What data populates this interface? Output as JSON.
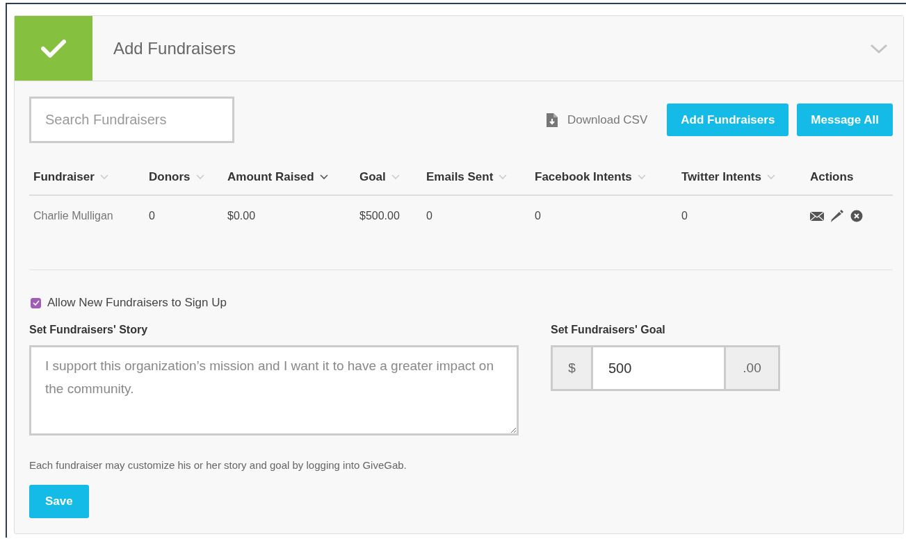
{
  "panel": {
    "title": "Add Fundraisers",
    "completed": true,
    "expanded": true
  },
  "toolbar": {
    "search": {
      "placeholder": "Search Fundraisers"
    },
    "download_link": "Download CSV",
    "buttons": [
      "Add Fundraisers",
      "Message All"
    ]
  },
  "table": {
    "columns": [
      {
        "label": "Fundraiser",
        "sortable": true,
        "sorted": false
      },
      {
        "label": "Donors",
        "sortable": true,
        "sorted": false
      },
      {
        "label": "Amount Raised",
        "sortable": true,
        "sorted": true
      },
      {
        "label": "Goal",
        "sortable": true,
        "sorted": false
      },
      {
        "label": "Emails Sent",
        "sortable": true,
        "sorted": false
      },
      {
        "label": "Facebook Intents",
        "sortable": true,
        "sorted": false
      },
      {
        "label": "Twitter Intents",
        "sortable": true,
        "sorted": false
      },
      {
        "label": "Actions",
        "sortable": false
      }
    ],
    "rows": [
      {
        "cells": [
          "Charlie Mulligan",
          "0",
          "$0.00",
          "$500.00",
          "0",
          "0",
          "0"
        ]
      }
    ]
  },
  "settings": {
    "allow_signup": {
      "label": "Allow New Fundraisers to Sign Up",
      "checked": true
    },
    "story": {
      "label": "Set Fundraisers' Story",
      "placeholder": "I support this organization’s mission and I want it to have a greater impact on the community."
    },
    "goal": {
      "label": "Set Fundraisers' Goal",
      "prefix": "$",
      "value": "500",
      "suffix": ".00"
    },
    "note": "Each fundraiser may customize his or her story and goal by logging into GiveGab.",
    "save_button": "Save"
  }
}
